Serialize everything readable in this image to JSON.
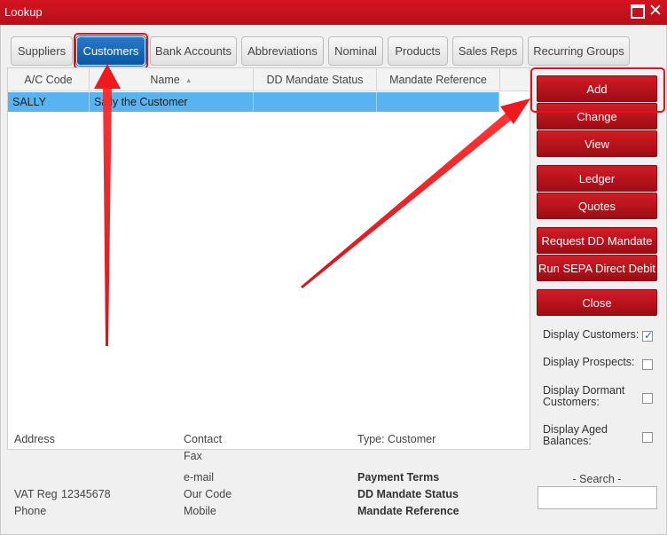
{
  "window": {
    "title": "Lookup"
  },
  "tabs": [
    {
      "label": "Suppliers",
      "active": false
    },
    {
      "label": "Customers",
      "active": true
    },
    {
      "label": "Bank Accounts",
      "active": false
    },
    {
      "label": "Abbreviations",
      "active": false
    },
    {
      "label": "Nominal",
      "active": false
    },
    {
      "label": "Products",
      "active": false
    },
    {
      "label": "Sales Reps",
      "active": false
    },
    {
      "label": "Recurring Groups",
      "active": false
    }
  ],
  "grid": {
    "columns": [
      "A/C Code",
      "Name",
      "DD Mandate Status",
      "Mandate Reference"
    ],
    "sort_indicator": "▲",
    "rows": [
      {
        "code": "SALLY",
        "name": "Sally the Customer",
        "dd_status": "",
        "mandate_ref": ""
      }
    ]
  },
  "details": {
    "address_label": "Address",
    "vat_label": "VAT Reg",
    "vat_value": "12345678",
    "phone_label": "Phone",
    "contact_label": "Contact",
    "fax_label": "Fax",
    "email_label": "e-mail",
    "our_code_label": "Our Code",
    "mobile_label": "Mobile",
    "type_label": "Type: Customer",
    "payment_terms_label": "Payment Terms",
    "dd_status_label": "DD Mandate Status",
    "mandate_ref_label": "Mandate Reference"
  },
  "buttons": {
    "add": "Add",
    "change": "Change",
    "view": "View",
    "ledger": "Ledger",
    "quotes": "Quotes",
    "request_dd": "Request DD Mandate",
    "run_sepa": "Run SEPA Direct Debit",
    "close": "Close"
  },
  "options": {
    "display_customers": {
      "label": "Display Customers:",
      "checked": true
    },
    "display_prospects": {
      "label": "Display Prospects:",
      "checked": false
    },
    "display_dormant": {
      "label_line1": "Display Dormant",
      "label_line2": "Customers:",
      "checked": false
    },
    "display_aged": {
      "label_line1": "Display Aged",
      "label_line2": "Balances:",
      "checked": false
    }
  },
  "search": {
    "label": "- Search -",
    "value": ""
  },
  "colors": {
    "title_bar": "#c8121c",
    "button_red": "#b8141d",
    "active_tab": "#0a57a4",
    "selected_row": "#58b4f0",
    "annotation_red": "#e8101a"
  }
}
